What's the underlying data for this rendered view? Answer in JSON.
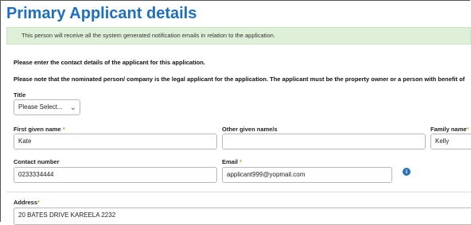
{
  "heading": "Primary Applicant details",
  "notice": "This person will receive all the system generated notification emails in relation to the application.",
  "instructions": [
    "Please enter the contact details of the applicant for this application.",
    "Please note that the nominated person/ company is the legal applicant for the application. The applicant must be the property owner or a person with benefit of"
  ],
  "required_marker": "*",
  "fields": {
    "title": {
      "label": "Title",
      "value": "Please Select...",
      "icon": "chevron-down-icon"
    },
    "first_name": {
      "label": "First given name",
      "value": "Kate"
    },
    "other_names": {
      "label": "Other given name/s",
      "value": ""
    },
    "family_name": {
      "label": "Family name",
      "value": "Kelly"
    },
    "contact_number": {
      "label": "Contact number",
      "value": "0233334444"
    },
    "email": {
      "label": "Email",
      "value": "applicant999@yopmail.com",
      "info_icon": "info-icon"
    },
    "address": {
      "label": "Address",
      "value": "20 BATES DRIVE KAREELA 2232"
    }
  },
  "colors": {
    "heading": "#1f6fbf",
    "notice_bg": "#dff0d8",
    "required": "#e8962e",
    "info_icon": "#2a72b5"
  }
}
